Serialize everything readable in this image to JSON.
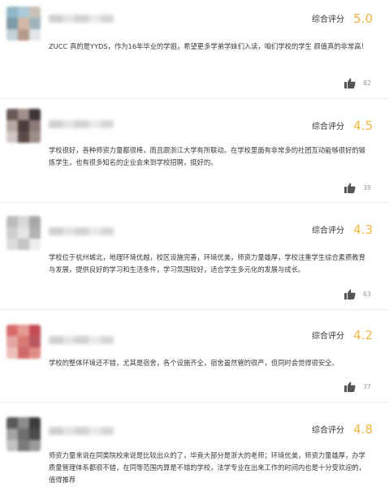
{
  "score_label": "综合评分",
  "reviews": [
    {
      "score": "5.0",
      "content": "ZUCC 真的是YYDS，作为16年毕业的学姐，希望更多学弟学妹们入读，咱们学校的学生 颜值真的非常高！",
      "likes": "82",
      "avatar_colors": [
        "#8fb7c9",
        "#a9cad6",
        "#c9c1b6",
        "#7d9aa8",
        "#d6b8a8",
        "#9fb3bc",
        "#c4d2d8",
        "#b59a88",
        "#e2e6e8"
      ]
    },
    {
      "score": "4.5",
      "content": "学校很好，各种师资力量都很棒，而且跟浙江大学有所联动。在学校里面有非常多的社团互动能够很好的锻炼学生，也有很多知名的企业会来到学校招聘，挺好的。",
      "likes": "39",
      "avatar_colors": [
        "#6b5a57",
        "#a08f8a",
        "#3e3434",
        "#b8a8a2",
        "#4a3d3c",
        "#8c7b78",
        "#d2c6c2",
        "#5a4b48",
        "#9c8d89"
      ]
    },
    {
      "score": "4.3",
      "content": "学校位于杭州城北，地理环境优越，校区设施完善，环境优美，师资力量雄厚，学校注重学生综合素质教育与发展，提供良好的学习和生活条件，学习氛围较好，适合学生多元化的发展与成长。",
      "likes": "63",
      "avatar_colors": [
        "#bdbdbd",
        "#d8d8d8",
        "#a7a7a7",
        "#cfcfcf",
        "#e6e6e6",
        "#b2b2b2",
        "#dcdcdc",
        "#c4c4c4",
        "#ededed"
      ]
    },
    {
      "score": "4.2",
      "content": "学校的整体环境还不错，尤其是宿舍，各个设施齐全，宿舍虽然管的很严，但同时会觉得很安全。",
      "likes": "37",
      "avatar_colors": [
        "#d96b6b",
        "#e79a92",
        "#c44b55",
        "#e5a5a0",
        "#d67a73",
        "#b9585f",
        "#efc0b9",
        "#cf6a6a",
        "#e08a86"
      ]
    },
    {
      "score": "4.8",
      "content": "师资力量来说在同类院校来说是比较出众的了，毕竟大部分是浙大的老师；环境优美，师资力量雄厚，办学质量管理体系都很不错，在同等范围内算是不错的学校，法学专业在出来工作的时间内也是十分受欢迎的，值得推荐",
      "likes": "",
      "avatar_colors": [
        "#5a5a5a",
        "#8c8c8c",
        "#3d3d3d",
        "#a3a3a3",
        "#6e6e6e",
        "#4b4b4b",
        "#c2c2c2",
        "#7a7a7a",
        "#9a9a9a"
      ]
    }
  ]
}
